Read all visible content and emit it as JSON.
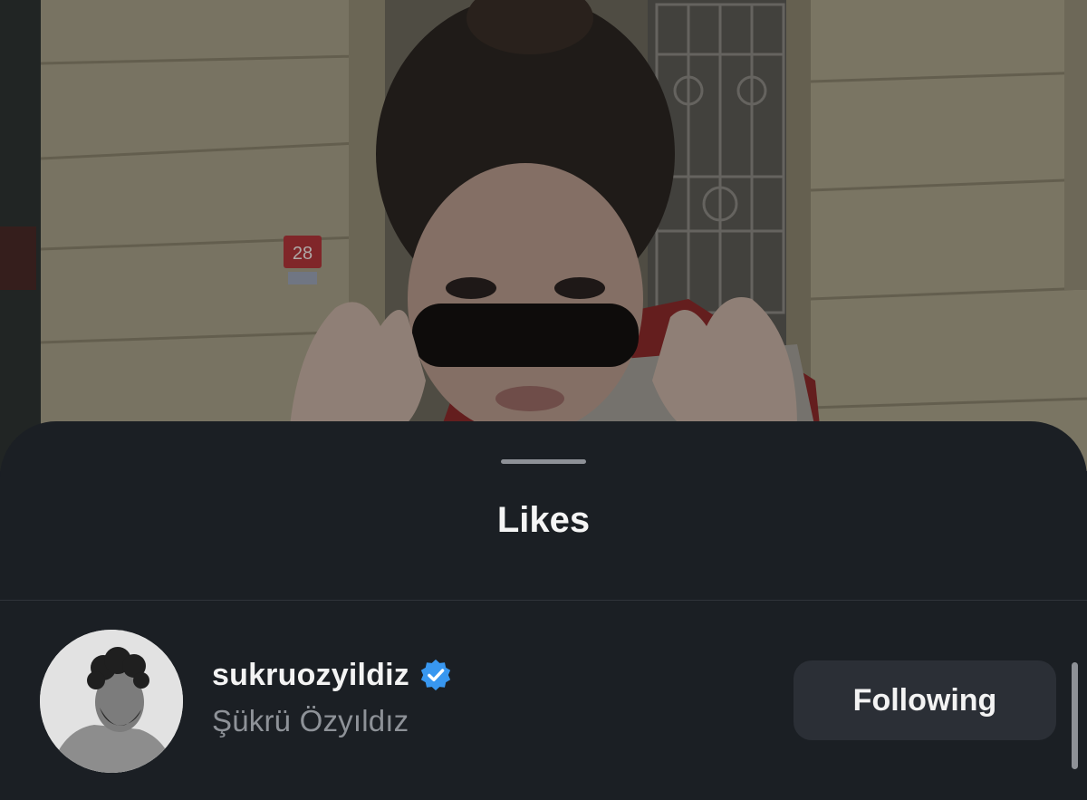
{
  "post": {
    "house_number": "28"
  },
  "likes_sheet": {
    "title": "Likes",
    "users": [
      {
        "username": "sukruozyildiz",
        "full_name": "Şükrü Özyıldız",
        "verified": true,
        "button_label": "Following"
      }
    ]
  },
  "colors": {
    "sheet_background": "#1b1f24",
    "button_background": "#2b2f36",
    "verified_badge": "#3897f0",
    "secondary_text": "#8e9298"
  },
  "icons": {
    "verified": "verified-badge-icon"
  }
}
